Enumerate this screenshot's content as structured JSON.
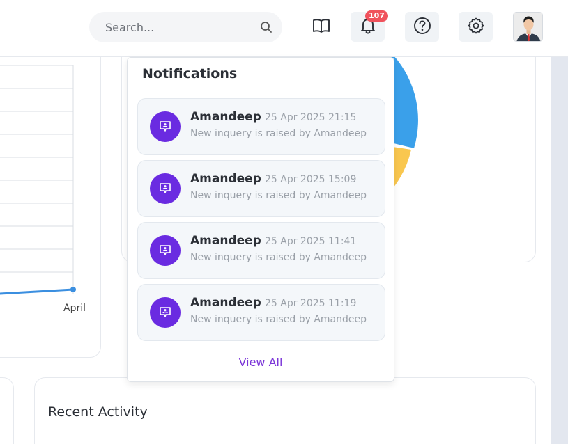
{
  "header": {
    "search_placeholder": "Search...",
    "notification_count": "107",
    "icons": [
      "search-icon",
      "book-icon",
      "bell-icon",
      "help-icon",
      "gear-icon",
      "avatar"
    ]
  },
  "chart": {
    "x_label": "April"
  },
  "notifications": {
    "title": "Notifications",
    "items": [
      {
        "name": "Amandeep",
        "time": "25 Apr 2025 21:15",
        "message": "New inquery is raised by Amandeep"
      },
      {
        "name": "Amandeep",
        "time": "25 Apr 2025 15:09",
        "message": "New inquery is raised by Amandeep"
      },
      {
        "name": "Amandeep",
        "time": "25 Apr 2025 11:41",
        "message": "New inquery is raised by Amandeep"
      },
      {
        "name": "Amandeep",
        "time": "25 Apr 2025 11:19",
        "message": "New inquery is raised by Amandeep"
      }
    ],
    "view_all_label": "View All"
  },
  "recent_activity": {
    "title": "Recent Activity"
  },
  "colors": {
    "accent": "#6a2be1",
    "badge": "#f0525c",
    "pie_blue": "#3aa0ea",
    "pie_yellow": "#f9c74f",
    "line_blue": "#3b8fe0"
  }
}
